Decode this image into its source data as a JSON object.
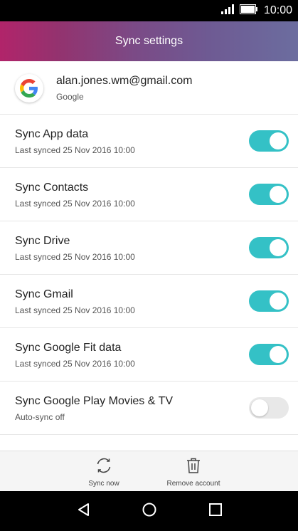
{
  "status_bar": {
    "time": "10:00"
  },
  "header": {
    "title": "Sync settings"
  },
  "account": {
    "email": "alan.jones.wm@gmail.com",
    "type": "Google"
  },
  "sync_items": [
    {
      "title": "Sync App data",
      "subtitle": "Last synced 25 Nov 2016 10:00",
      "enabled": true
    },
    {
      "title": "Sync Contacts",
      "subtitle": "Last synced 25 Nov 2016 10:00",
      "enabled": true
    },
    {
      "title": "Sync Drive",
      "subtitle": "Last synced 25 Nov 2016 10:00",
      "enabled": true
    },
    {
      "title": "Sync Gmail",
      "subtitle": "Last synced 25 Nov 2016 10:00",
      "enabled": true
    },
    {
      "title": "Sync Google Fit data",
      "subtitle": "Last synced 25 Nov 2016 10:00",
      "enabled": true
    },
    {
      "title": "Sync Google Play Movies & TV",
      "subtitle": "Auto-sync off",
      "enabled": false
    }
  ],
  "actions": {
    "sync_now": "Sync now",
    "remove_account": "Remove account"
  },
  "colors": {
    "toggle_on": "#34c1c6",
    "toggle_off": "#e8e8e8",
    "header_start": "#b1246a",
    "header_end": "#6c6d9f"
  }
}
